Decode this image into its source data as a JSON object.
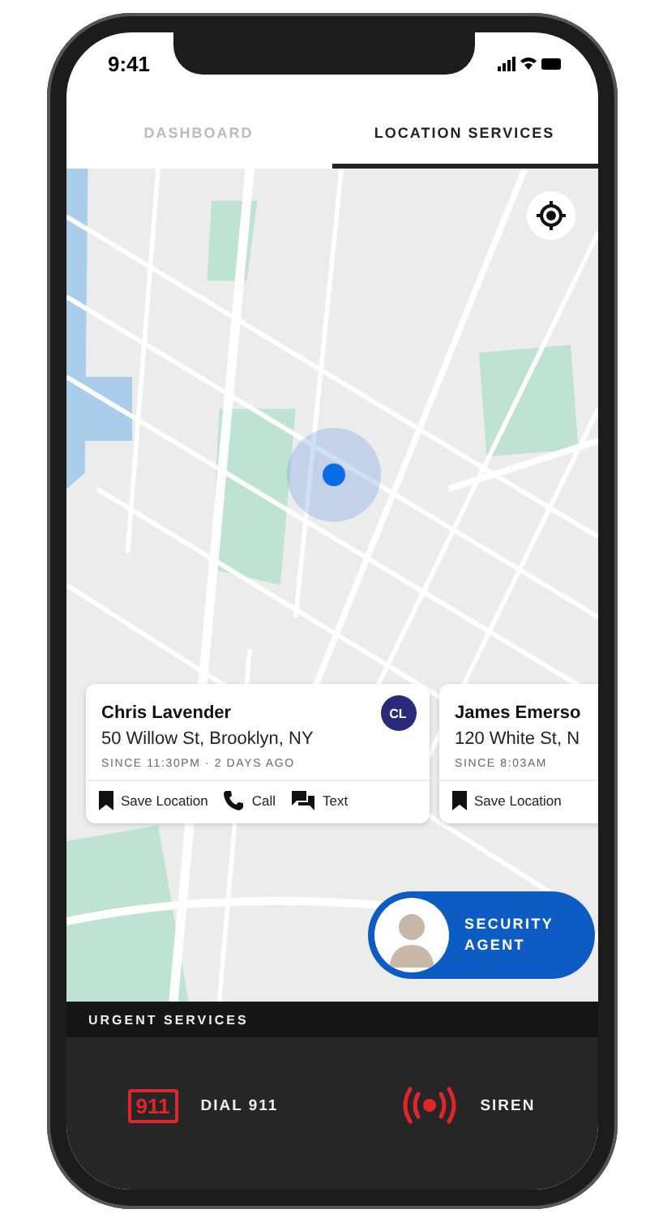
{
  "status_bar": {
    "time": "9:41"
  },
  "tabs": [
    {
      "label": "DASHBOARD",
      "selected": false
    },
    {
      "label": "LOCATION SERVICES",
      "selected": true
    }
  ],
  "contacts": [
    {
      "name": "Chris Lavender",
      "address": "50 Willow St, Brooklyn, NY",
      "since": "SINCE 11:30PM · 2 DAYS AGO",
      "avatar": {
        "initials": "CL",
        "color": "#2a2a7a"
      },
      "actions": [
        {
          "kind": "save",
          "label": "Save Location"
        },
        {
          "kind": "call",
          "label": "Call"
        },
        {
          "kind": "text",
          "label": "Text"
        }
      ]
    },
    {
      "name": "James Emerso",
      "address": "120 White St, N",
      "since": "SINCE 8:03AM",
      "actions": [
        {
          "kind": "save",
          "label": "Save Location"
        }
      ]
    }
  ],
  "agent": {
    "label": "SECURITY AGENT"
  },
  "urgent_services": {
    "title": "URGENT SERVICES",
    "buttons": [
      {
        "kind": "dial",
        "badge": "911",
        "label": "DIAL 911"
      },
      {
        "kind": "siren",
        "label": "SIREN"
      }
    ]
  }
}
